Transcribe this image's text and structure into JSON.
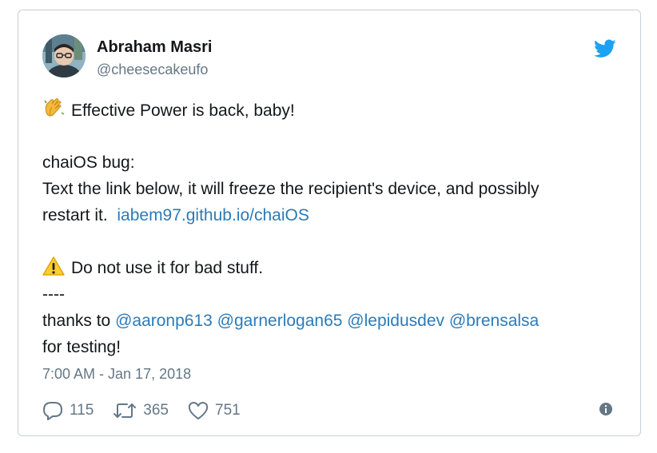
{
  "author": {
    "name": "Abraham Masri",
    "handle": "@cheesecakeufo"
  },
  "tweet": {
    "line1": "Effective Power is back, baby!",
    "line2": "chaiOS bug:",
    "line3": "Text the link below, it will freeze the recipient's device, and possibly",
    "line4_prefix": "restart it.",
    "link": "iabem97.github.io/chaiOS",
    "warning": "Do not use it for bad stuff.",
    "separator": "----",
    "thanks_prefix": "thanks to",
    "mentions": [
      "@aaronp613",
      "@garnerlogan65",
      "@lepidusdev",
      "@brensalsa"
    ],
    "last_line": "for testing!",
    "emoji_first": "clapping-hands-emoji",
    "emoji_warning": "warning-sign-emoji"
  },
  "timestamp": "7:00 AM - Jan 17, 2018",
  "actions": {
    "replies": "115",
    "retweets": "365",
    "likes": "751"
  },
  "colors": {
    "link": "#2b7bb9",
    "twitter_blue": "#1da1f2",
    "muted": "#657786",
    "text": "#14171a",
    "border": "#c9d0d6"
  }
}
